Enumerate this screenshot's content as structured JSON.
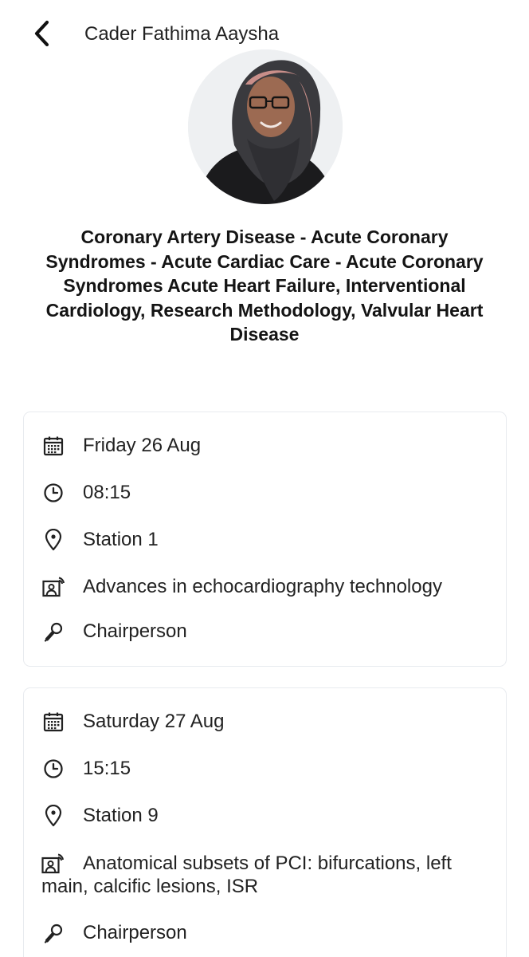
{
  "header": {
    "title": "Cader Fathima Aaysha"
  },
  "profile": {
    "specialties": "Coronary Artery Disease - Acute Coronary Syndromes - Acute Cardiac Care - Acute Coronary Syndromes Acute Heart Failure, Interventional Cardiology, Research Methodology, Valvular Heart Disease"
  },
  "sessions": [
    {
      "date": "Friday 26 Aug",
      "time": "08:15",
      "location": "Station 1",
      "title": "Advances in echocardiography technology",
      "role": "Chairperson"
    },
    {
      "date": "Saturday 27 Aug",
      "time": "15:15",
      "location": "Station 9",
      "title": "Anatomical subsets of PCI: bifurcations, left main, calcific lesions, ISR",
      "role": "Chairperson"
    }
  ],
  "icons": {
    "back": "chevron-left-icon",
    "date": "calendar-icon",
    "time": "clock-icon",
    "location": "map-pin-icon",
    "session": "presentation-icon",
    "role": "microphone-icon"
  },
  "colors": {
    "text": "#222222",
    "card_border": "#e8ebef",
    "background": "#ffffff"
  }
}
